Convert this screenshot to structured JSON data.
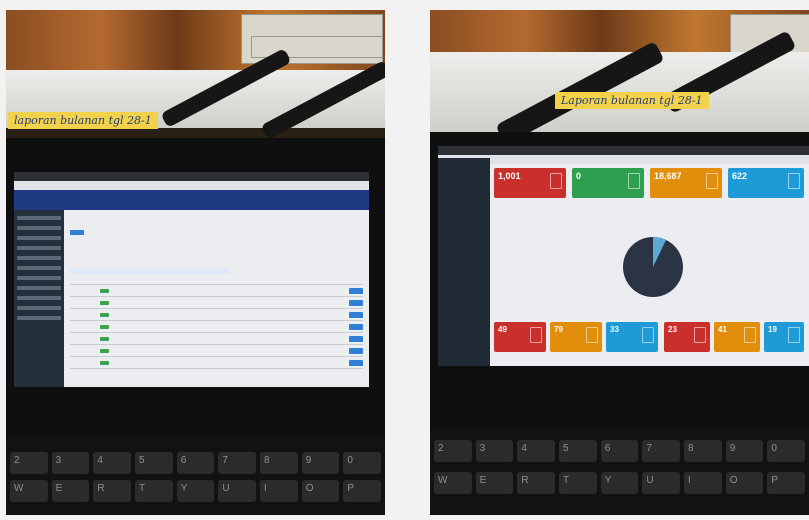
{
  "notes": {
    "left": "laporan bulanan tgl 28-1",
    "right": "Laporan bulanan tgl 28-1"
  },
  "dashboard": {
    "stats_top": [
      {
        "value": "1,001",
        "color": "#c9302c"
      },
      {
        "value": "0",
        "color": "#2e9e4f"
      },
      {
        "value": "18,687",
        "color": "#e08e0b"
      },
      {
        "value": "622",
        "color": "#1e9ad6"
      }
    ],
    "stats_bottom": [
      {
        "value": "49",
        "color": "#c9302c"
      },
      {
        "value": "79",
        "color": "#e08e0b"
      },
      {
        "value": "33",
        "color": "#1e9ad6"
      },
      {
        "value": "23",
        "color": "#c9302c"
      },
      {
        "value": "41",
        "color": "#e08e0b"
      },
      {
        "value": "19",
        "color": "#1e9ad6"
      }
    ],
    "pie_colors": [
      "#2b3444",
      "#5fa8d3"
    ]
  },
  "keyboard": {
    "row1": [
      "2",
      "3",
      "4",
      "5",
      "6",
      "7",
      "8",
      "9",
      "0"
    ],
    "row2": [
      "W",
      "E",
      "R",
      "T",
      "Y",
      "U",
      "I",
      "O",
      "P"
    ]
  }
}
